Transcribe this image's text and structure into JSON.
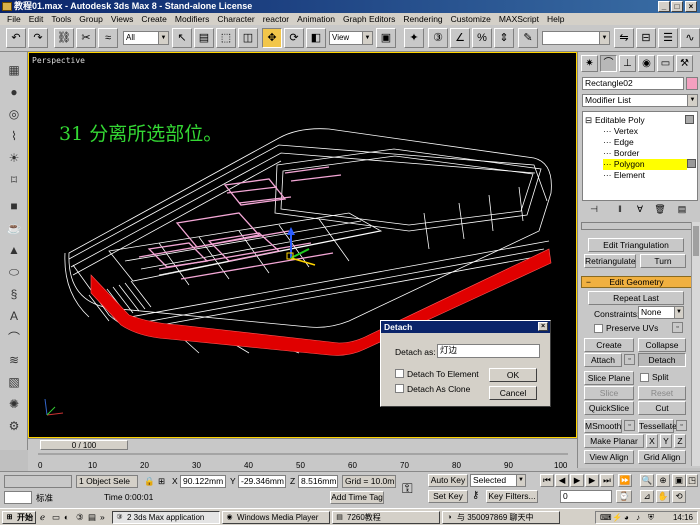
{
  "window": {
    "title": "教程01.max - Autodesk 3ds Max 8 - Stand-alone License",
    "min": "_",
    "max": "□",
    "close": "×"
  },
  "menu": [
    "File",
    "Edit",
    "Tools",
    "Group",
    "Views",
    "Create",
    "Modifiers",
    "Character",
    "reactor",
    "Animation",
    "Graph Editors",
    "Rendering",
    "Customize",
    "MAXScript",
    "Help"
  ],
  "toolbar": {
    "selection_filter": "All",
    "ref_coord": "View",
    "named_sel": ""
  },
  "viewport": {
    "label": "Perspective",
    "caption": "31 分离所选部位。"
  },
  "panel": {
    "object_name": "Rectangle02",
    "object_color": "#f5a0c0",
    "modifier_list": "Modifier List",
    "stack": {
      "root": "Editable Poly",
      "items": [
        "Vertex",
        "Edge",
        "Border",
        "Polygon",
        "Element"
      ],
      "selected": "Polygon"
    },
    "edit_triangulation": "Edit Triangulation",
    "retriangulate": "Retriangulate",
    "turn": "Turn",
    "edit_geometry": "Edit Geometry",
    "repeat_last": "Repeat Last",
    "constraints_label": "Constraints:",
    "constraints_value": "None",
    "preserve_uvs": "Preserve UVs",
    "create": "Create",
    "collapse": "Collapse",
    "attach": "Attach",
    "detach": "Detach",
    "slice_plane": "Slice Plane",
    "split": "Split",
    "slice": "Slice",
    "reset_plane": "Reset Plane",
    "quickslice": "QuickSlice",
    "cut": "Cut",
    "msmooth": "MSmooth",
    "tessellate": "Tessellate",
    "make_planar": "Make Planar",
    "x": "X",
    "y": "Y",
    "z": "Z",
    "view_align": "View Align",
    "grid_align": "Grid Align"
  },
  "dialog": {
    "title": "Detach",
    "detach_as_label": "Detach as:",
    "detach_as_value": "灯边",
    "detach_to_element": "Detach To Element",
    "detach_as_clone": "Detach As Clone",
    "ok": "OK",
    "cancel": "Cancel"
  },
  "timeline": {
    "position": "0 / 100",
    "ticks": [
      "0",
      "10",
      "20",
      "30",
      "40",
      "50",
      "60",
      "70",
      "80",
      "90",
      "100"
    ]
  },
  "status": {
    "selection": "1 Object Sele",
    "x": "90.122mm",
    "y": "-29.346mm",
    "z": "8.516mm",
    "grid": "Grid = 10.0mm",
    "auto_key": "Auto Key",
    "key_mode": "Selected",
    "set_key": "Set Key",
    "key_filters": "Key Filters...",
    "time_label": "Time 0:00:01",
    "add_time_tag": "Add Time Tag",
    "frame": "0",
    "prompt_tag": "标准"
  },
  "taskbar": {
    "start": "开始",
    "tasks": [
      "2 3ds Max application",
      "Windows Media Player",
      "7260教程",
      "与 350097869 聊天中"
    ],
    "clock": "14:16"
  }
}
